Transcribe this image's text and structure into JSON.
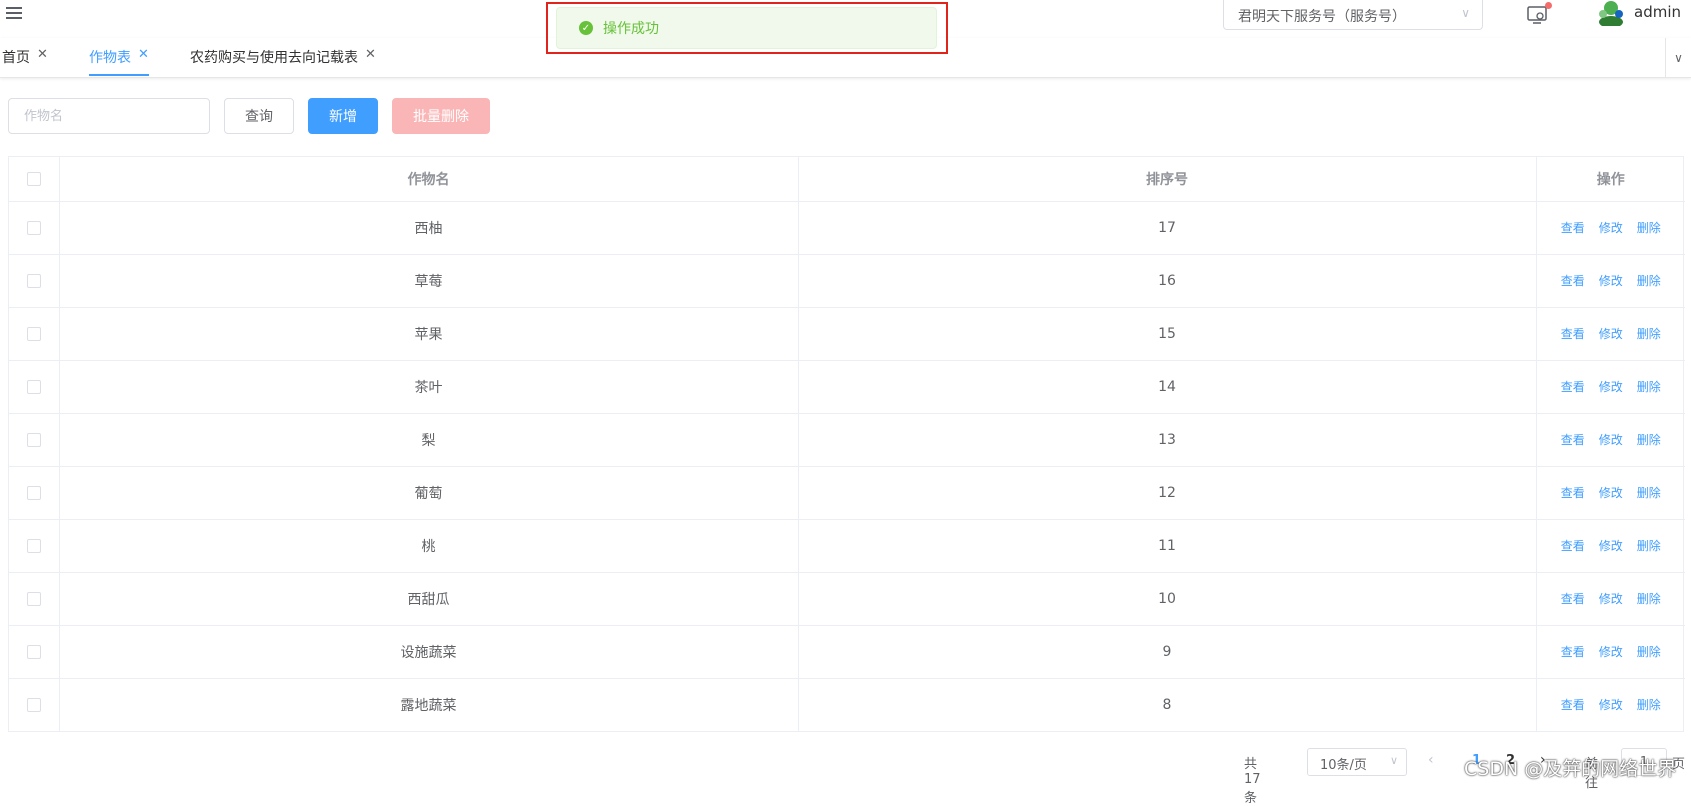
{
  "header": {
    "service_select": "君明天下服务号（服务号）",
    "user_name": "admin"
  },
  "tabs": [
    {
      "label": "首页",
      "active": false
    },
    {
      "label": "作物表",
      "active": true
    },
    {
      "label": "农药购买与使用去向记载表",
      "active": false
    }
  ],
  "toast": {
    "message": "操作成功"
  },
  "toolbar": {
    "search_placeholder": "作物名",
    "query_label": "查询",
    "add_label": "新增",
    "batch_delete_label": "批量删除"
  },
  "table": {
    "columns": [
      "作物名",
      "排序号",
      "操作"
    ],
    "rows": [
      {
        "name": "西柚",
        "sort": "17"
      },
      {
        "name": "草莓",
        "sort": "16"
      },
      {
        "name": "苹果",
        "sort": "15"
      },
      {
        "name": "茶叶",
        "sort": "14"
      },
      {
        "name": "梨",
        "sort": "13"
      },
      {
        "name": "葡萄",
        "sort": "12"
      },
      {
        "name": "桃",
        "sort": "11"
      },
      {
        "name": "西甜瓜",
        "sort": "10"
      },
      {
        "name": "设施蔬菜",
        "sort": "9"
      },
      {
        "name": "露地蔬菜",
        "sort": "8"
      }
    ],
    "actions": {
      "view": "查看",
      "edit": "修改",
      "delete": "删除"
    }
  },
  "pagination": {
    "total_text": "共 17 条",
    "page_size": "10条/页",
    "pages": [
      "1",
      "2"
    ],
    "goto_label": "前往",
    "goto_value": "1",
    "page_suffix": "页"
  },
  "watermark": "CSDN @及笄的网络世界",
  "colors": {
    "primary": "#409eff",
    "success": "#67c23a",
    "danger_light": "#fab6b6",
    "highlight": "#e0241b"
  }
}
